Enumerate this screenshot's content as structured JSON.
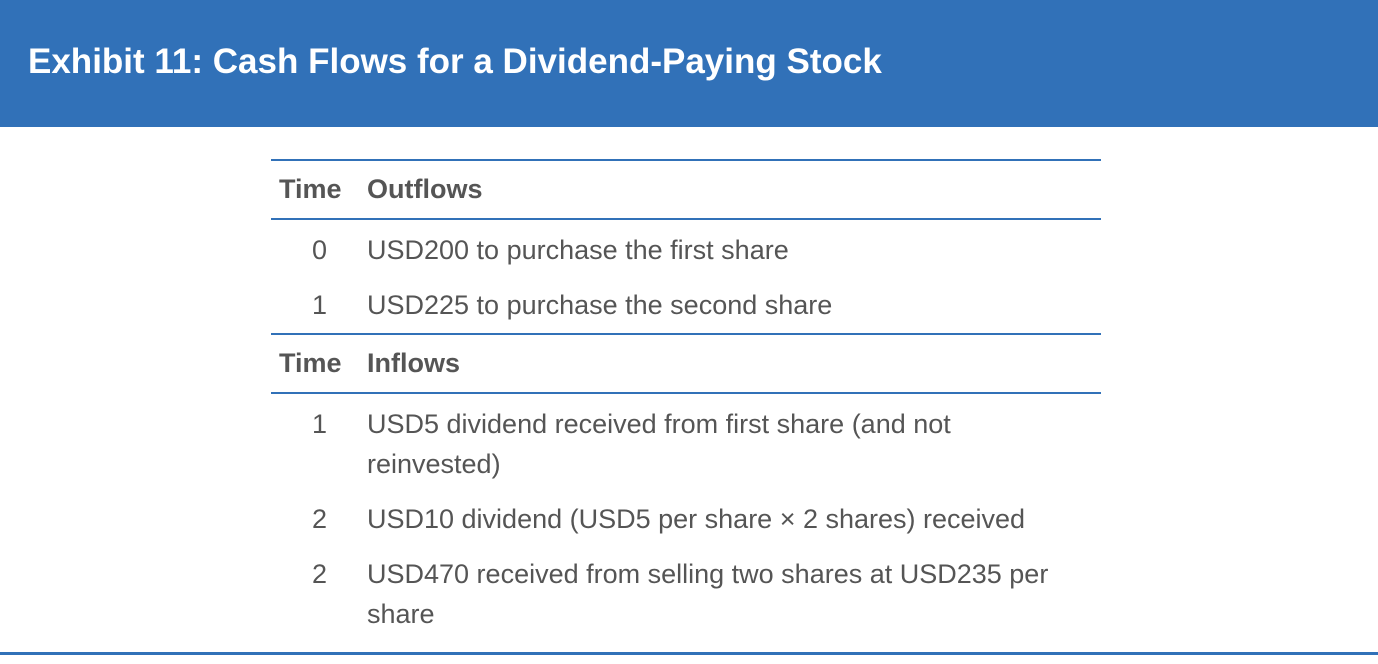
{
  "exhibit_title": "Exhibit 11: Cash Flows for a Dividend-Paying Stock",
  "outflows": {
    "time_header": "Time",
    "label_header": "Outflows",
    "rows": [
      {
        "time": "0",
        "text": "USD200 to purchase the first share"
      },
      {
        "time": "1",
        "text": "USD225 to purchase the second share"
      }
    ]
  },
  "inflows": {
    "time_header": "Time",
    "label_header": "Inflows",
    "rows": [
      {
        "time": "1",
        "text": "USD5 dividend received from first share (and not reinvested)"
      },
      {
        "time": "2",
        "text": "USD10 dividend (USD5 per share × 2 shares) received"
      },
      {
        "time": "2",
        "text": "USD470 received from selling two shares at USD235 per share"
      }
    ]
  },
  "colors": {
    "accent": "#3171b8",
    "text": "#555555",
    "header_text": "#ffffff"
  }
}
